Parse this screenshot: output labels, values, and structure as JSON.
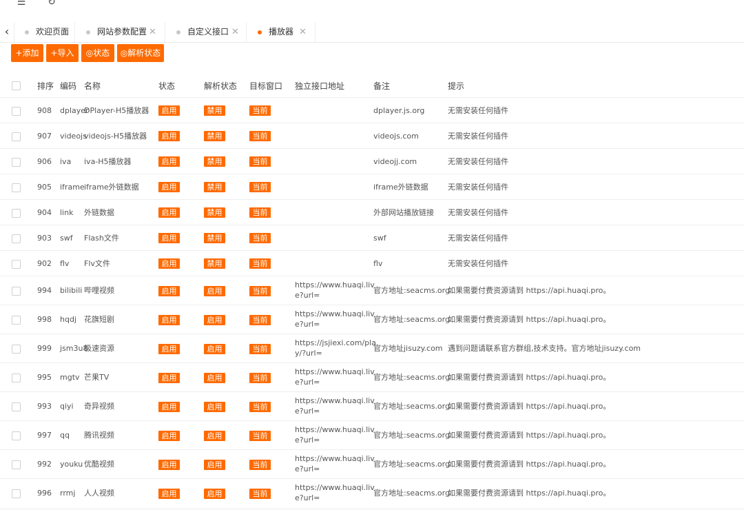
{
  "topbar": {
    "menu_icon": "menu-toggle-icon",
    "refresh_icon": "refresh-icon"
  },
  "tabs": [
    {
      "label": "欢迎页面",
      "closable": false,
      "active": false
    },
    {
      "label": "网站参数配置",
      "closable": true,
      "active": false
    },
    {
      "label": "自定义接口",
      "closable": true,
      "active": false
    },
    {
      "label": "播放器",
      "closable": true,
      "active": true
    }
  ],
  "toolbar": {
    "add": "+添加",
    "import": "+导入",
    "status": "◎状态",
    "parse_status": "◎解析状态"
  },
  "columns": [
    "排序",
    "编码",
    "名称",
    "状态",
    "解析状态",
    "目标窗口",
    "独立接口地址",
    "备注",
    "提示"
  ],
  "rows": [
    {
      "sort": "908",
      "code": "dplayer",
      "name": "DPlayer-H5播放器",
      "status": "启用",
      "parse": "禁用",
      "target": "当前",
      "url": "",
      "note": "dplayer.js.org",
      "tip": "无需安装任何插件"
    },
    {
      "sort": "907",
      "code": "videojs",
      "name": "videojs-H5播放器",
      "status": "启用",
      "parse": "禁用",
      "target": "当前",
      "url": "",
      "note": "videojs.com",
      "tip": "无需安装任何插件"
    },
    {
      "sort": "906",
      "code": "iva",
      "name": "iva-H5播放器",
      "status": "启用",
      "parse": "禁用",
      "target": "当前",
      "url": "",
      "note": "videojj.com",
      "tip": "无需安装任何插件"
    },
    {
      "sort": "905",
      "code": "iframe",
      "name": "iframe外链数据",
      "status": "启用",
      "parse": "禁用",
      "target": "当前",
      "url": "",
      "note": "iframe外链数据",
      "tip": "无需安装任何插件"
    },
    {
      "sort": "904",
      "code": "link",
      "name": "外链数据",
      "status": "启用",
      "parse": "禁用",
      "target": "当前",
      "url": "",
      "note": "外部网站播放链接",
      "tip": "无需安装任何插件"
    },
    {
      "sort": "903",
      "code": "swf",
      "name": "Flash文件",
      "status": "启用",
      "parse": "禁用",
      "target": "当前",
      "url": "",
      "note": "swf",
      "tip": "无需安装任何插件"
    },
    {
      "sort": "902",
      "code": "flv",
      "name": "Flv文件",
      "status": "启用",
      "parse": "禁用",
      "target": "当前",
      "url": "",
      "note": "flv",
      "tip": "无需安装任何插件"
    },
    {
      "sort": "994",
      "code": "bilibili",
      "name": "哔哩视频",
      "status": "启用",
      "parse": "启用",
      "target": "当前",
      "url": "https://www.huaqi.live?url=",
      "note": "官方地址:seacms.org",
      "tip": "如果需要付费资源请到 https://api.huaqi.pro。"
    },
    {
      "sort": "998",
      "code": "hqdj",
      "name": "花旗短剧",
      "status": "启用",
      "parse": "启用",
      "target": "当前",
      "url": "https://www.huaqi.live?url=",
      "note": "官方地址:seacms.org",
      "tip": "如果需要付费资源请到 https://api.huaqi.pro。"
    },
    {
      "sort": "999",
      "code": "jsm3u8",
      "name": "极速资源",
      "status": "启用",
      "parse": "启用",
      "target": "当前",
      "url": "https://jsjiexi.com/play/?url=",
      "note": "官方地址jisuzy.com",
      "tip": "遇到问题请联系官方群组,技术支持。官方地址jisuzy.com"
    },
    {
      "sort": "995",
      "code": "mgtv",
      "name": "芒果TV",
      "status": "启用",
      "parse": "启用",
      "target": "当前",
      "url": "https://www.huaqi.live?url=",
      "note": "官方地址:seacms.org",
      "tip": "如果需要付费资源请到 https://api.huaqi.pro。"
    },
    {
      "sort": "993",
      "code": "qiyi",
      "name": "奇异视频",
      "status": "启用",
      "parse": "启用",
      "target": "当前",
      "url": "https://www.huaqi.live?url=",
      "note": "官方地址:seacms.org",
      "tip": "如果需要付费资源请到 https://api.huaqi.pro。"
    },
    {
      "sort": "997",
      "code": "qq",
      "name": "腾讯视频",
      "status": "启用",
      "parse": "启用",
      "target": "当前",
      "url": "https://www.huaqi.live?url=",
      "note": "官方地址:seacms.org",
      "tip": "如果需要付费资源请到 https://api.huaqi.pro。"
    },
    {
      "sort": "992",
      "code": "youku",
      "name": "优酷视频",
      "status": "启用",
      "parse": "启用",
      "target": "当前",
      "url": "https://www.huaqi.live?url=",
      "note": "官方地址:seacms.org",
      "tip": "如果需要付费资源请到 https://api.huaqi.pro。"
    },
    {
      "sort": "996",
      "code": "rrmj",
      "name": "人人视频",
      "status": "启用",
      "parse": "启用",
      "target": "当前",
      "url": "https://www.huaqi.live?url=",
      "note": "官方地址:seacms.org",
      "tip": "如果需要付费资源请到 https://api.huaqi.pro。"
    }
  ],
  "colors": {
    "accent": "#ff6a00",
    "inactive_dot": "#c8c8c8"
  }
}
